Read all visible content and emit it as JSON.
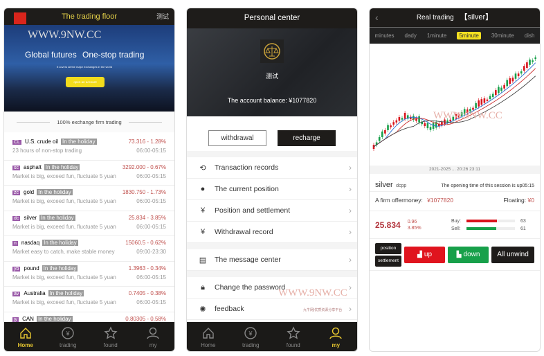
{
  "home": {
    "title": "The trading floor",
    "user": "测试",
    "banner": {
      "watermark": "WWW.9NW.CC",
      "headline_left": "Global futures",
      "headline_right": "One-stop trading",
      "subtitle": "It covers all the major exchanges in the world",
      "cta": "open an account"
    },
    "divider": "100% exchange firm trading",
    "items": [
      {
        "code": "CL",
        "name": "U.S. crude oil",
        "status": "In the holiday",
        "quote": "73.316 - 1.28%",
        "desc": "23 hours of non-stop trading",
        "hours": "06:00-05:15"
      },
      {
        "code": "sc",
        "name": "asphalt",
        "status": "In the holiday",
        "quote": "3292.000 - 0.67%",
        "desc": "Market is big, exceed fun, fluctuate 5 yuan",
        "hours": "06:00-05:15"
      },
      {
        "code": "zc",
        "name": "gold",
        "status": "In the holiday",
        "quote": "1830.750 - 1.73%",
        "desc": "Market is big, exceed fun, fluctuate 5 yuan",
        "hours": "06:00-05:15"
      },
      {
        "code": "dc",
        "name": "silver",
        "status": "In the holiday",
        "quote": "25.834 - 3.85%",
        "desc": "Market is big, exceed fun, fluctuate 5 yuan",
        "hours": "06:00-05:15"
      },
      {
        "code": "n",
        "name": "nasdaq",
        "status": "In the holiday",
        "quote": "15060.5 - 0.62%",
        "desc": "Market easy to catch, make stable money",
        "hours": "09:00-23:30"
      },
      {
        "code": "yb",
        "name": "pound",
        "status": "In the holiday",
        "quote": "1.3963 - 0.34%",
        "desc": "Market is big, exceed fun, fluctuate 5 yuan",
        "hours": "06:00-05:15"
      },
      {
        "code": "av",
        "name": "Australia",
        "status": "In the holiday",
        "quote": "0.7405 - 0.38%",
        "desc": "Market is big, exceed fun, fluctuate 5 yuan",
        "hours": "06:00-05:15"
      },
      {
        "code": "jy",
        "name": "CAN",
        "status": "In the holiday",
        "quote": "0.80305 - 0.58%",
        "desc": "",
        "hours": ""
      }
    ]
  },
  "tabs": [
    {
      "label": "Home",
      "icon": "home-icon"
    },
    {
      "label": "trading",
      "icon": "yen-circle-icon"
    },
    {
      "label": "found",
      "icon": "star-icon"
    },
    {
      "label": "my",
      "icon": "user-icon"
    }
  ],
  "personal": {
    "title": "Personal center",
    "username": "测试",
    "balance_label": "The account balance:",
    "balance": "¥1077820",
    "withdrawal": "withdrawal",
    "recharge": "recharge",
    "menu": [
      {
        "label": "Transaction records",
        "icon": "clock-dollar-icon"
      },
      {
        "label": "The current position",
        "icon": "position-icon"
      },
      {
        "label": "Position and settlement",
        "icon": "hand-yen-icon"
      },
      {
        "label": "Withdrawal record",
        "icon": "hand-yen-icon"
      },
      {
        "label": "The message center",
        "icon": "message-icon"
      },
      {
        "label": "Change the password",
        "icon": "lock-icon"
      },
      {
        "label": "feedback",
        "icon": "bulb-icon"
      }
    ],
    "watermark": "WWW.9NW.CC",
    "watermark_sub": "九牛网|优质资源分享平台"
  },
  "trade": {
    "title": "Real trading",
    "symbol": "【silver】",
    "periods": [
      "minutes",
      "dady",
      "1minute",
      "5minute",
      "30minute",
      "dish"
    ],
    "active_period": "5minute",
    "time_axis": "2021-2025 ... 20:26 23:11",
    "watermark": "WWW.9NW.CC",
    "name": "silver",
    "code": "dcpp",
    "session": "The opening time of this session is up05:15",
    "firm_label": "A firm offermoney:",
    "firm_value": "¥1077820",
    "floating_label": "Floating:",
    "floating_value": "¥0",
    "price": "25.834",
    "change": "0.96",
    "change_pct": "3.85%",
    "buy_label": "Buy:",
    "buy": 63,
    "sell_label": "Sell:",
    "sell": 61,
    "position": "position",
    "settlement": "settlement",
    "up": "up",
    "down": "down",
    "unwind": "All unwind",
    "colors": {
      "up": "#e0141e",
      "down": "#17a04a",
      "accent": "#f5e020"
    }
  }
}
